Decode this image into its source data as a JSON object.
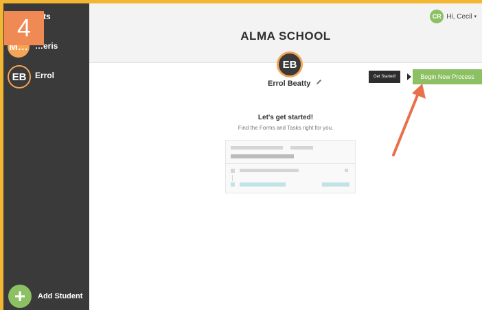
{
  "sidebar": {
    "items": [
      {
        "initials": "",
        "name": "…ts"
      },
      {
        "initials": "M…",
        "name": "…eris"
      },
      {
        "initials": "EB",
        "name": "Errol"
      }
    ],
    "add_student": {
      "icon": "plus-icon",
      "label": "Add Student"
    }
  },
  "step_badge": "4",
  "header": {
    "school_name": "ALMA SCHOOL",
    "user_initials": "CR",
    "greeting": "Hi, Cecil",
    "caret": "▾"
  },
  "student": {
    "initials": "EB",
    "name": "Errol Beatty",
    "edit_icon": "pencil-icon"
  },
  "actions": {
    "tooltip": "Get Started!",
    "begin_label": "Begin New Process"
  },
  "intro": {
    "title": "Let's get started!",
    "subtitle": "Find the Forms and Tasks right for you."
  },
  "colors": {
    "accent_yellow": "#f2b632",
    "avatar_orange": "#f5a455",
    "green": "#8cc063",
    "sidebar": "#3a3a3a",
    "arrow": "#e8704a",
    "step_badge": "#f08a55"
  }
}
